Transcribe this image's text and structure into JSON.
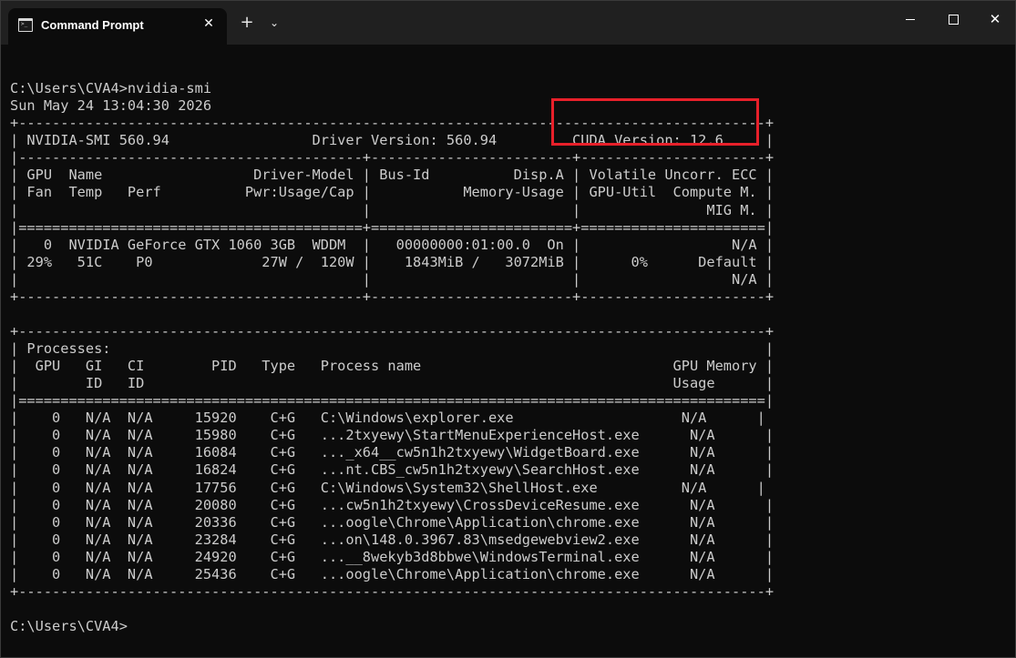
{
  "window": {
    "tab_title": "Command Prompt",
    "tab_close_glyph": "✕",
    "new_tab_glyph": "+",
    "dropdown_glyph": "⌄",
    "close_glyph": "✕"
  },
  "terminal": {
    "lines": [
      "",
      "C:\\Users\\CVA4>nvidia-smi",
      "Sun May 24 13:04:30 2026",
      "+-----------------------------------------------------------------------------------------+",
      "| NVIDIA-SMI 560.94                 Driver Version: 560.94         CUDA Version: 12.6     |",
      "|-----------------------------------------+------------------------+----------------------+",
      "| GPU  Name                  Driver-Model | Bus-Id          Disp.A | Volatile Uncorr. ECC |",
      "| Fan  Temp   Perf          Pwr:Usage/Cap |           Memory-Usage | GPU-Util  Compute M. |",
      "|                                         |                        |               MIG M. |",
      "|=========================================+========================+======================|",
      "|   0  NVIDIA GeForce GTX 1060 3GB  WDDM  |   00000000:01:00.0  On |                  N/A |",
      "| 29%   51C    P0             27W /  120W |    1843MiB /   3072MiB |      0%      Default |",
      "|                                         |                        |                  N/A |",
      "+-----------------------------------------+------------------------+----------------------+",
      "",
      "+-----------------------------------------------------------------------------------------+",
      "| Processes:                                                                              |",
      "|  GPU   GI   CI        PID   Type   Process name                              GPU Memory |",
      "|        ID   ID                                                               Usage      |",
      "|=========================================================================================|",
      "|    0   N/A  N/A     15920    C+G   C:\\Windows\\explorer.exe                    N/A      |",
      "|    0   N/A  N/A     15980    C+G   ...2txyewy\\StartMenuExperienceHost.exe      N/A      |",
      "|    0   N/A  N/A     16084    C+G   ..._x64__cw5n1h2txyewy\\WidgetBoard.exe      N/A      |",
      "|    0   N/A  N/A     16824    C+G   ...nt.CBS_cw5n1h2txyewy\\SearchHost.exe      N/A      |",
      "|    0   N/A  N/A     17756    C+G   C:\\Windows\\System32\\ShellHost.exe          N/A      |",
      "|    0   N/A  N/A     20080    C+G   ...cw5n1h2txyewy\\CrossDeviceResume.exe      N/A      |",
      "|    0   N/A  N/A     20336    C+G   ...oogle\\Chrome\\Application\\chrome.exe      N/A      |",
      "|    0   N/A  N/A     23284    C+G   ...on\\148.0.3967.83\\msedgewebview2.exe      N/A      |",
      "|    0   N/A  N/A     24920    C+G   ...__8wekyb3d8bbwe\\WindowsTerminal.exe      N/A      |",
      "|    0   N/A  N/A     25436    C+G   ...oogle\\Chrome\\Application\\chrome.exe      N/A      |",
      "+-----------------------------------------------------------------------------------------+",
      "",
      "C:\\Users\\CVA4>"
    ]
  },
  "colors": {
    "background": "#0c0c0c",
    "titlebar": "#202020",
    "text": "#cccccc",
    "highlight_border": "#e8202a"
  }
}
